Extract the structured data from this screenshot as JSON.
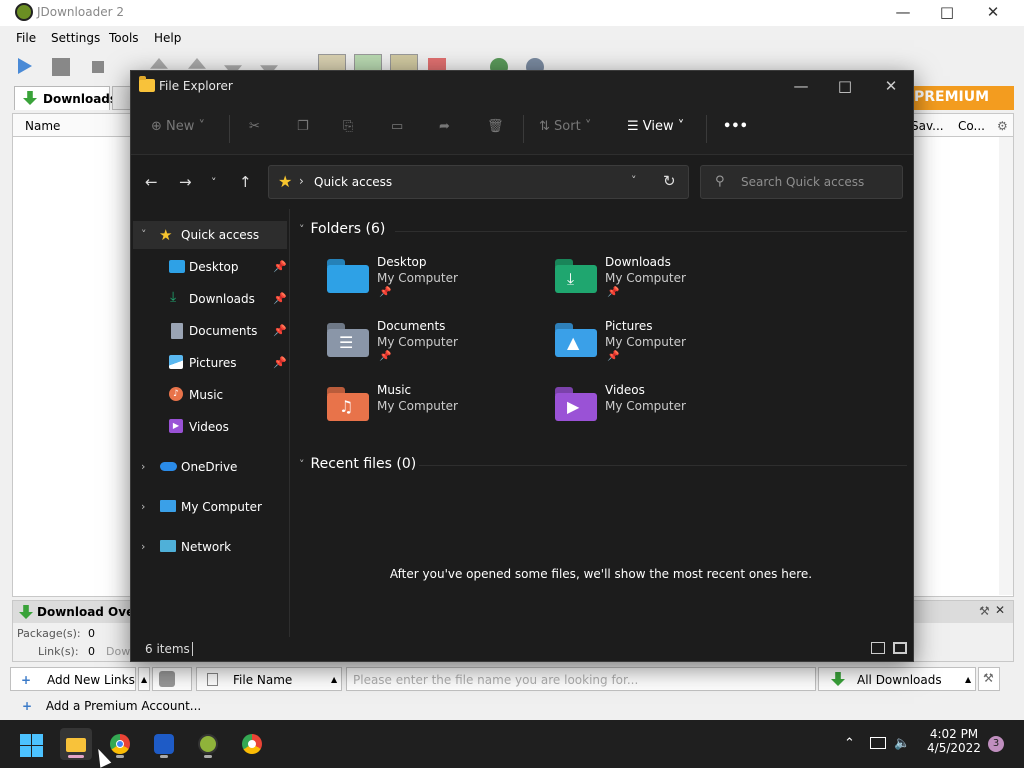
{
  "jdownloader": {
    "title": "JDownloader 2",
    "menu": [
      "File",
      "Settings",
      "Tools",
      "Help"
    ],
    "tab_downloads": "Downloads",
    "premium_banner": "PREMIUM",
    "columns": {
      "name": "Name",
      "save": "Sav...",
      "comment": "Co..."
    },
    "overview": {
      "title": "Download Overvie",
      "packages_label": "Package(s):",
      "packages_value": "0",
      "links_label": "Link(s):",
      "links_value": "0",
      "down_label": "Dow"
    },
    "bottom": {
      "add_links": "Add New Links",
      "file_name": "File Name",
      "search_placeholder": "Please enter the file name you are looking for...",
      "all_downloads": "All Downloads",
      "add_premium": "Add a Premium Account..."
    }
  },
  "explorer": {
    "title": "File Explorer",
    "cmdbar": {
      "new": "New",
      "sort": "Sort",
      "view": "View",
      "more": "•••"
    },
    "address": "Quick access",
    "search_placeholder": "Search Quick access",
    "sidebar": [
      {
        "label": "Quick access",
        "icon": "star-icon"
      },
      {
        "label": "Desktop",
        "icon": "desktop-icon"
      },
      {
        "label": "Downloads",
        "icon": "download-icon"
      },
      {
        "label": "Documents",
        "icon": "documents-icon"
      },
      {
        "label": "Pictures",
        "icon": "pictures-icon"
      },
      {
        "label": "Music",
        "icon": "music-icon"
      },
      {
        "label": "Videos",
        "icon": "videos-icon"
      },
      {
        "label": "OneDrive",
        "icon": "cloud-icon"
      },
      {
        "label": "My Computer",
        "icon": "computer-icon"
      },
      {
        "label": "Network",
        "icon": "network-icon"
      }
    ],
    "folders_header": "Folders (6)",
    "folders": [
      {
        "name": "Desktop",
        "location": "My Computer",
        "color": "#2ea1e6"
      },
      {
        "name": "Downloads",
        "location": "My Computer",
        "color": "#1fa66f"
      },
      {
        "name": "Documents",
        "location": "My Computer",
        "color": "#8a96a8"
      },
      {
        "name": "Pictures",
        "location": "My Computer",
        "color": "#3aa0e8"
      },
      {
        "name": "Music",
        "location": "My Computer",
        "color": "#e8734a"
      },
      {
        "name": "Videos",
        "location": "My Computer",
        "color": "#9a52d6"
      }
    ],
    "recent_header": "Recent files (0)",
    "recent_empty": "After you've opened some files, we'll show the most recent ones here.",
    "status": "6 items"
  },
  "taskbar": {
    "time": "4:02 PM",
    "date": "4/5/2022",
    "notifications": "3"
  }
}
